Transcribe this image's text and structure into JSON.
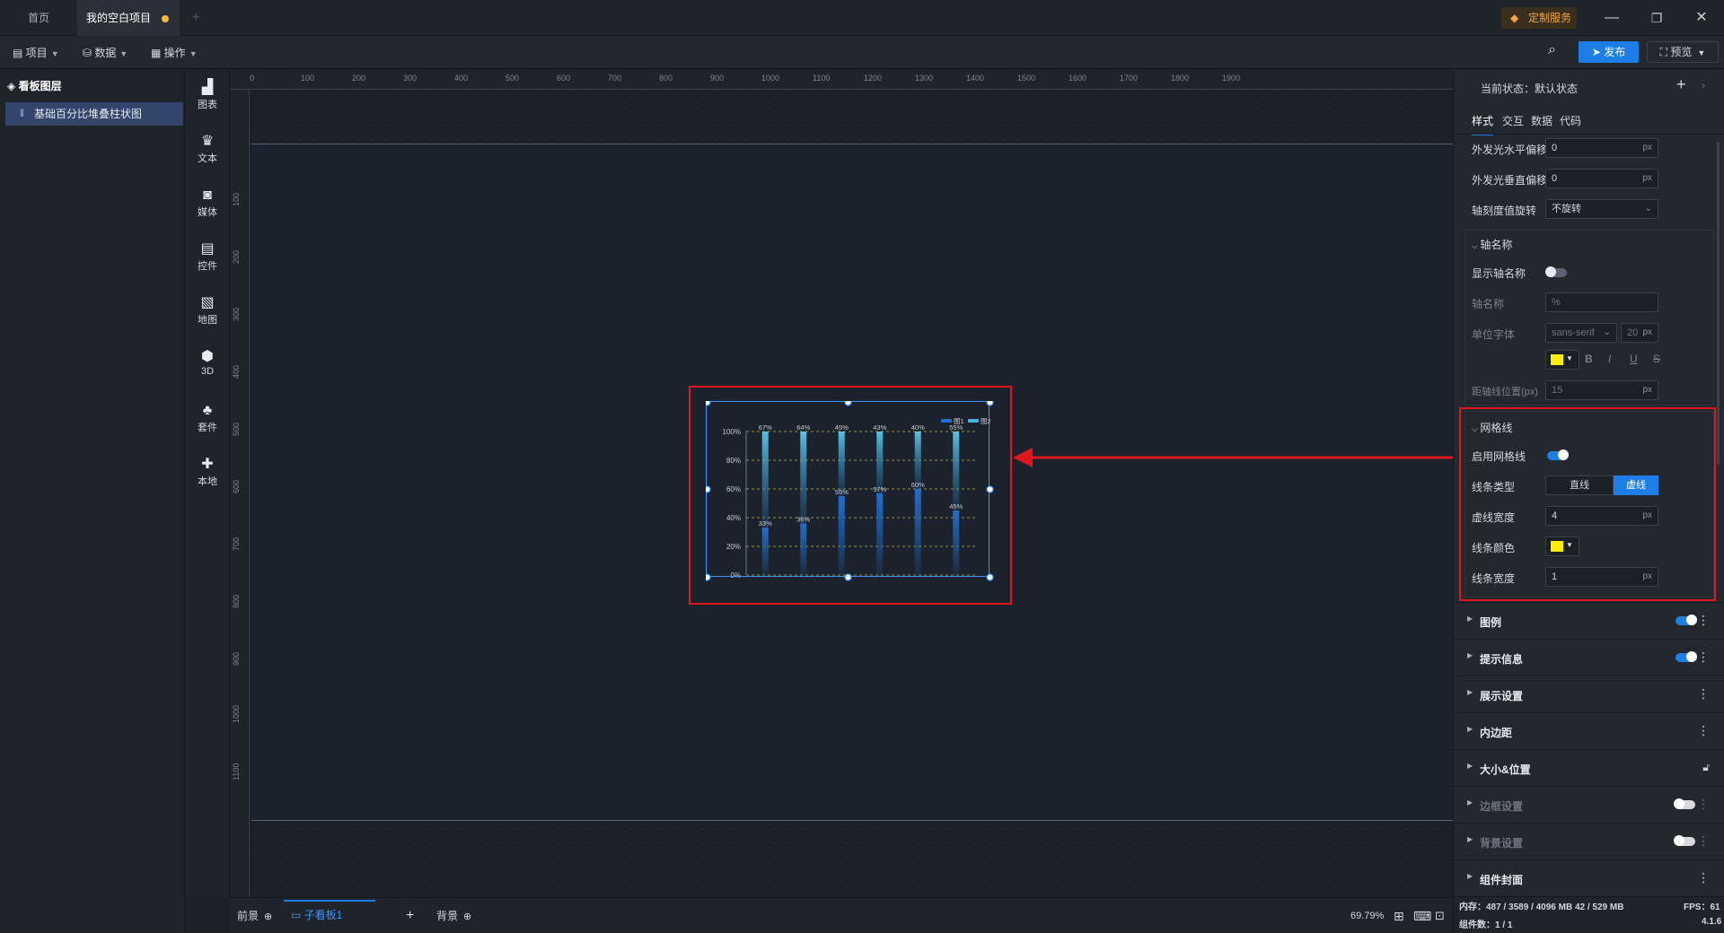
{
  "titlebar": {
    "tabs": [
      {
        "label": "首页"
      },
      {
        "label": "我的空白项目"
      }
    ],
    "custom_service": "定制服务"
  },
  "menubar": {
    "items": [
      {
        "label": "项目"
      },
      {
        "label": "数据"
      },
      {
        "label": "操作"
      }
    ],
    "publish": "发布",
    "preview": "预览"
  },
  "layers": {
    "title": "看板图层",
    "items": [
      {
        "label": "基础百分比堆叠柱状图"
      }
    ]
  },
  "tools": [
    {
      "label": "图表",
      "icon": "bar-chart-icon"
    },
    {
      "label": "文本",
      "icon": "text-icon"
    },
    {
      "label": "媒体",
      "icon": "media-icon"
    },
    {
      "label": "控件",
      "icon": "control-icon"
    },
    {
      "label": "地图",
      "icon": "map-icon"
    },
    {
      "label": "3D",
      "icon": "cube-icon"
    },
    {
      "label": "套件",
      "icon": "kit-icon"
    },
    {
      "label": "本地",
      "icon": "puzzle-icon"
    }
  ],
  "ruler": {
    "h": [
      "0",
      "100",
      "200",
      "300",
      "400",
      "500",
      "600",
      "700",
      "800",
      "900",
      "1000",
      "1100",
      "1200",
      "1300",
      "1400",
      "1500",
      "1600",
      "1700",
      "1800",
      "1900"
    ],
    "v": [
      "100",
      "200",
      "300",
      "400",
      "500",
      "600",
      "700",
      "800",
      "900",
      "1000",
      "1100"
    ]
  },
  "chart_data": {
    "type": "bar",
    "categories": [
      "",
      "",
      "",
      "",
      "",
      ""
    ],
    "series": [
      {
        "name": "图1",
        "values": [
          33,
          36,
          55,
          57,
          60,
          45
        ]
      },
      {
        "name": "图2",
        "values": [
          67,
          64,
          45,
          43,
          40,
          55
        ]
      }
    ],
    "data_labels": {
      "series1": [
        "33%",
        "36%",
        "55%",
        "57%",
        "60%",
        "45%"
      ],
      "series2": [
        "67%",
        "64%",
        "45%",
        "43%",
        "40%",
        "55%"
      ]
    },
    "yticks": [
      "0%",
      "20%",
      "40%",
      "60%",
      "80%",
      "100%"
    ],
    "ylim": [
      0,
      100
    ],
    "stacked": "percent",
    "grid": "dashed",
    "grid_color": "#ffee00",
    "legend": "top-right",
    "colors": [
      "#1e6fd0",
      "#43b3e0"
    ]
  },
  "bottombar": {
    "foreground": "前景",
    "sub_board": "子看板1",
    "background": "背景",
    "zoom": "69.79%"
  },
  "right_panel": {
    "state_label": "当前状态：",
    "state_value": "默认状态",
    "tabs": [
      {
        "label": "样式"
      },
      {
        "label": "交互"
      },
      {
        "label": "数据"
      },
      {
        "label": "代码"
      }
    ],
    "glow_h": {
      "label": "外发光水平偏移",
      "value": "0",
      "unit": "px"
    },
    "glow_v": {
      "label": "外发光垂直偏移",
      "value": "0",
      "unit": "px"
    },
    "tick_rotate": {
      "label": "轴刻度值旋转",
      "value": "不旋转"
    },
    "axis_name": {
      "title": "轴名称",
      "show_label": "显示轴名称",
      "name_label": "轴名称",
      "name_value": "%",
      "font_label": "单位字体",
      "font_value": "sans-serif",
      "font_size": "20",
      "font_unit": "px",
      "distance_label": "距轴线位置(px)",
      "distance_value": "15",
      "distance_unit": "px",
      "color": "#ffee00"
    },
    "grid": {
      "title": "网格线",
      "enable_label": "启用网格线",
      "type_label": "线条类型",
      "type_solid": "直线",
      "type_dashed": "虚线",
      "dash_width_label": "虚线宽度",
      "dash_width_value": "4",
      "dash_width_unit": "px",
      "color_label": "线条颜色",
      "color": "#ffee00",
      "line_width_label": "线条宽度",
      "line_width_value": "1",
      "line_width_unit": "px"
    },
    "sections": [
      {
        "label": "图例"
      },
      {
        "label": "提示信息"
      },
      {
        "label": "展示设置"
      },
      {
        "label": "内边距"
      },
      {
        "label": "大小&位置"
      },
      {
        "label": "边框设置"
      },
      {
        "label": "背景设置"
      },
      {
        "label": "组件封面"
      }
    ],
    "status": {
      "memory": "内存：487 / 3589 / 4096 MB  42 / 529 MB",
      "fps": "FPS：61",
      "count": "组件数：1 / 1",
      "version": "4.1.6"
    }
  }
}
